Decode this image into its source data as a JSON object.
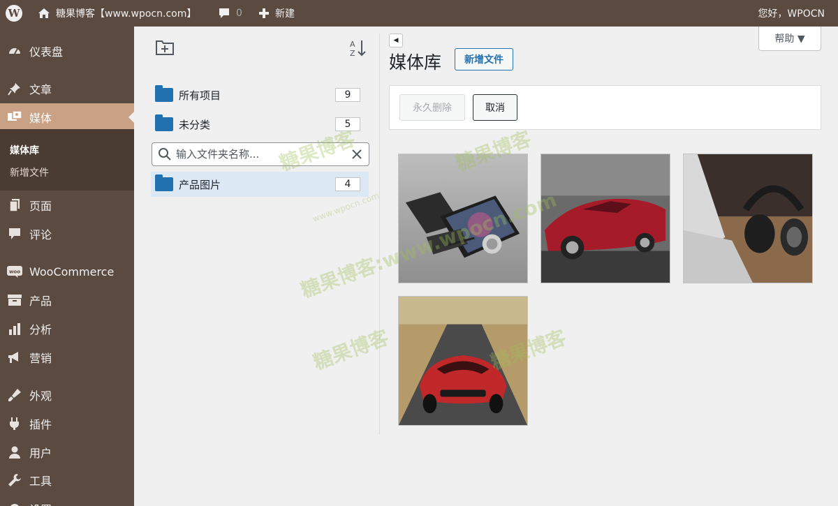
{
  "adminbar": {
    "site_title": "糖果博客【www.wpocn.com】",
    "comments_count": "0",
    "new_label": "新建",
    "greeting": "您好，WPOCN"
  },
  "sidebar": {
    "items": [
      {
        "label": "仪表盘",
        "icon": "dashboard-icon"
      },
      {
        "label": "文章",
        "icon": "pin-icon"
      },
      {
        "label": "媒体",
        "icon": "media-icon"
      },
      {
        "label": "页面",
        "icon": "page-icon"
      },
      {
        "label": "评论",
        "icon": "comment-icon"
      },
      {
        "label": "WooCommerce",
        "icon": "woo-icon"
      },
      {
        "label": "产品",
        "icon": "archive-icon"
      },
      {
        "label": "分析",
        "icon": "chart-icon"
      },
      {
        "label": "营销",
        "icon": "megaphone-icon"
      },
      {
        "label": "外观",
        "icon": "brush-icon"
      },
      {
        "label": "插件",
        "icon": "plugin-icon"
      },
      {
        "label": "用户",
        "icon": "user-icon"
      },
      {
        "label": "工具",
        "icon": "wrench-icon"
      },
      {
        "label": "设置",
        "icon": "settings-icon"
      }
    ],
    "submenu": [
      {
        "label": "媒体库"
      },
      {
        "label": "新增文件"
      }
    ]
  },
  "folders": {
    "items": [
      {
        "label": "所有项目",
        "count": "9"
      },
      {
        "label": "未分类",
        "count": "5"
      },
      {
        "label": "产品图片",
        "count": "4"
      }
    ],
    "search_placeholder": "输入文件夹名称..."
  },
  "main": {
    "title": "媒体库",
    "add_new": "新增文件",
    "help": "帮助 ▼",
    "delete_permanently": "永久删除",
    "cancel": "取消"
  },
  "watermark": {
    "main": "糖果博客",
    "long": "糖果博客:www.wpocn.com",
    "url": "www.wpocn.com"
  },
  "colors": {
    "adminbar_bg": "#5b4a40",
    "menu_current_bg": "#c9a285",
    "accent": "#2271b1"
  }
}
